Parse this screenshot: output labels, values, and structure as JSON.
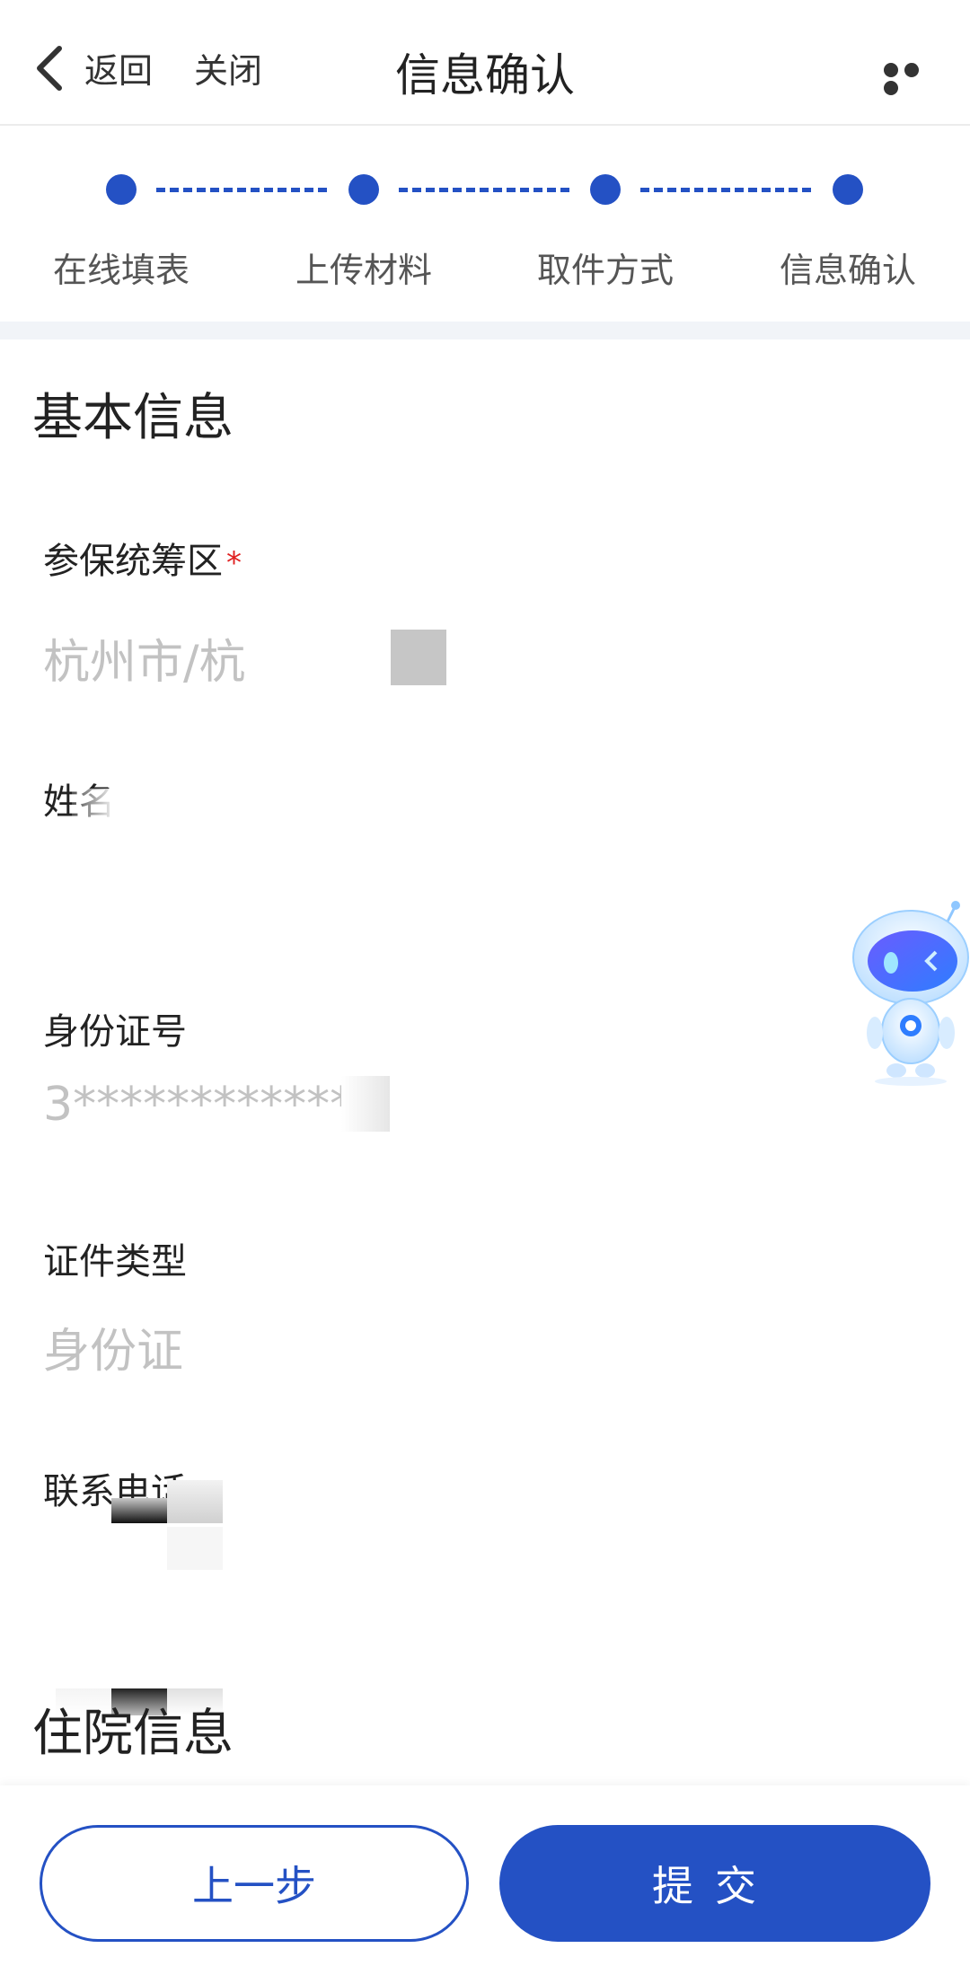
{
  "header": {
    "back_label": "返回",
    "close_label": "关闭",
    "title": "信息确认"
  },
  "steps": [
    {
      "label": "在线填表"
    },
    {
      "label": "上传材料"
    },
    {
      "label": "取件方式"
    },
    {
      "label": "信息确认"
    }
  ],
  "sections": {
    "basic_info": "基本信息",
    "hospital_info": "住院信息"
  },
  "fields": {
    "insured_region": {
      "label": "参保统筹区",
      "required_mark": "*",
      "value": "杭州市/杭"
    },
    "name": {
      "label": "姓名",
      "value": ""
    },
    "id_number": {
      "label": "身份证号",
      "value": "3*************"
    },
    "id_type": {
      "label": "证件类型",
      "value": "身份证"
    },
    "phone": {
      "label": "联系电话",
      "value": ""
    }
  },
  "buttons": {
    "prev": "上一步",
    "submit": "提交"
  },
  "colors": {
    "accent": "#2451c4",
    "required": "#e02020",
    "placeholder_text": "#c2c2c2"
  },
  "icons": {
    "back": "chevron-left-icon",
    "more": "more-dots-icon",
    "assistant": "robot-assistant-icon"
  }
}
